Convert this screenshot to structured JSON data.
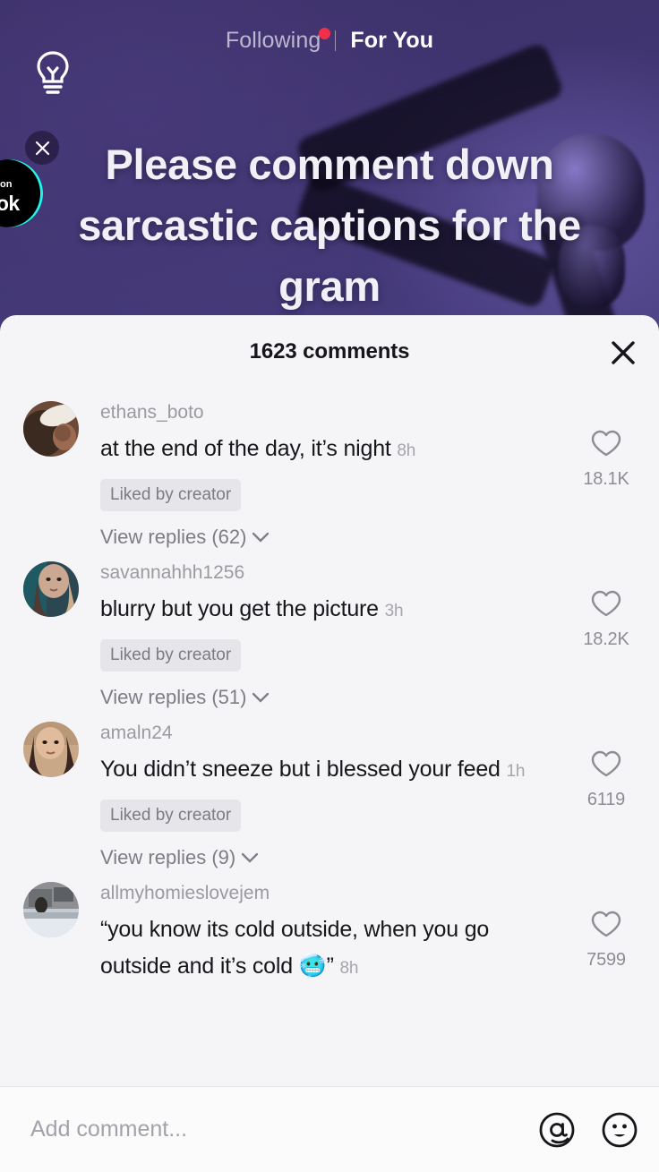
{
  "nav": {
    "bulb_icon": "lightbulb-icon",
    "tabs": [
      {
        "label": "Following",
        "active": false,
        "has_dot": true
      },
      {
        "label": "For You",
        "active": true,
        "has_dot": false
      }
    ]
  },
  "overlay": {
    "close_icon": "close-icon",
    "brand_badge_top": "on",
    "brand_badge_bottom": "Tok"
  },
  "video": {
    "caption": "Please comment down sarcastic captions for the gram"
  },
  "sheet": {
    "title": "1623 comments",
    "close_icon": "close-icon"
  },
  "comments": [
    {
      "username": "ethans_boto",
      "text": "at the end of the day, it’s night",
      "emoji": "",
      "time": "8h",
      "badge": "Liked by creator",
      "replies": "View replies (62)",
      "likes": "18.1K",
      "avatar_colors": [
        "#7c5a4a",
        "#3b2a22",
        "#efe9e2"
      ]
    },
    {
      "username": "savannahhh1256",
      "text": "blurry but you get the picture",
      "emoji": "",
      "time": "3h",
      "badge": "Liked by creator",
      "replies": "View replies (51)",
      "likes": "18.2K",
      "avatar_colors": [
        "#caa892",
        "#2b4852",
        "#6d5a58"
      ]
    },
    {
      "username": "amaln24",
      "text": "You didn’t sneeze but i blessed your feed",
      "emoji": "",
      "time": "1h",
      "badge": "Liked by creator",
      "replies": "View replies (9)",
      "likes": "6119",
      "avatar_colors": [
        "#d8b49a",
        "#4a3029",
        "#9aa7b4"
      ]
    },
    {
      "username": "allmyhomieslovejem",
      "text": "“you know its cold outside, when you go outside and it’s cold ",
      "emoji": "🥶",
      "text_after_emoji": "”",
      "time": "8h",
      "badge": "",
      "replies": "",
      "likes": "7599",
      "avatar_colors": [
        "#8d8f92",
        "#cfd6dd",
        "#3a3c40"
      ]
    }
  ],
  "composer": {
    "placeholder": "Add comment...",
    "value": "",
    "mention_icon": "at-mention-icon",
    "emoji_icon": "smiley-face-icon"
  },
  "colors": {
    "accent_red": "#fe2c55",
    "accent_cyan": "#25f4ee",
    "sheet_bg": "#f5f4f6",
    "text_primary": "#17161b",
    "text_muted": "#9b9aa1"
  }
}
